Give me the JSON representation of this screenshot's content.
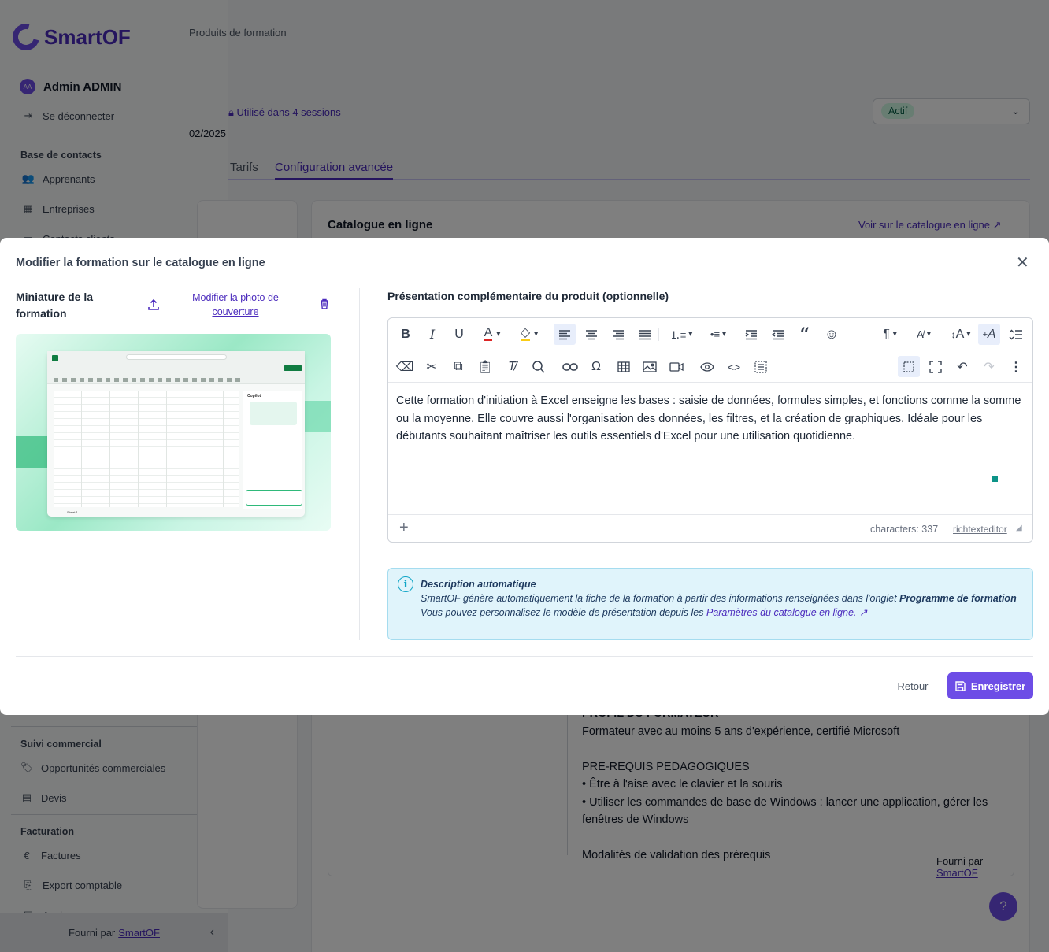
{
  "app": {
    "name": "SmartOF"
  },
  "sidebar": {
    "user_initials": "AA",
    "user_name": "Admin ADMIN",
    "logout": "Se déconnecter",
    "section_contacts": "Base de contacts",
    "items_contacts": [
      "Apprenants",
      "Entreprises",
      "Contacts clients"
    ],
    "section_commercial": "Suivi commercial",
    "items_commercial": [
      "Opportunités commerciales",
      "Devis"
    ],
    "section_billing": "Facturation",
    "items_billing": [
      "Factures",
      "Export comptable",
      "Avoirs"
    ],
    "footer_prefix": "Fourni par",
    "footer_link": "SmartOF"
  },
  "background": {
    "breadcrumb": "Produits de formation",
    "used_in_sessions": "Utilisé dans 4 sessions",
    "date": "02/2025",
    "status": "Actif",
    "tabs": [
      "Tarifs",
      "Configuration avancée"
    ],
    "card_title": "Catalogue en ligne",
    "catalog_link": "Voir sur le catalogue en ligne",
    "body_lines": [
      "PROFIL DU FORMATEUR",
      "Formateur avec au moins 5 ans d'expérience, certifié Microsoft",
      "",
      "PRE-REQUIS PEDAGOGIQUES",
      "• Être à l'aise avec le clavier et la souris",
      "• Utiliser les commandes de base de Windows : lancer une application, gérer les fenêtres de Windows",
      "",
      " Modalités de validation des prérequis"
    ],
    "provided_prefix": "Fourni par",
    "provided_link": "SmartOF",
    "help": "?"
  },
  "modal": {
    "title": "Modifier la formation sur le catalogue en ligne",
    "thumbnail_label": "Miniature de la formation",
    "change_photo": "Modifier la photo de couverture",
    "presentation_label": "Présentation complémentaire du produit (optionnelle)",
    "editor_text": "Cette formation d'initiation à Excel enseigne les bases : saisie de données, formules simples, et fonctions comme la somme ou la moyenne. Elle couvre aussi l'organisation des données, les filtres, et la création de graphiques. Idéale pour les débutants souhaitant maîtriser les outils essentiels d'Excel pour une utilisation quotidienne.",
    "char_count": "characters: 337",
    "rte_link": "richtexteditor",
    "info": {
      "title": "Description automatique",
      "line1_prefix": "SmartOF génère automatiquement la fiche de la formation à partir des informations renseignées dans l'onglet",
      "line1_bold": "Programme de formation",
      "line2_prefix": "Vous pouvez personnalisez le modèle de présentation depuis les",
      "line2_link": "Paramètres du catalogue en ligne."
    },
    "back_button": "Retour",
    "save_button": "Enregistrer"
  },
  "thumbnail_image": {
    "app_panel_title": "Copilot",
    "sheet_tab": "Sheet 1"
  },
  "colors": {
    "accent": "#6d4de6",
    "info_bg": "#e0f4fb",
    "status_bg": "#d1fae5"
  }
}
